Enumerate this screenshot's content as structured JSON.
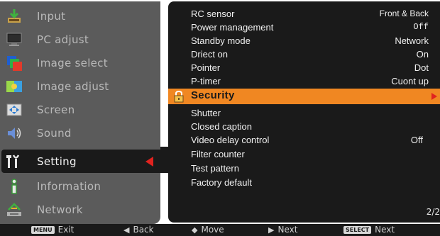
{
  "sidebar": {
    "items": [
      {
        "label": "Input",
        "icon": "input-icon"
      },
      {
        "label": "PC adjust",
        "icon": "pc-adjust-icon"
      },
      {
        "label": "Image select",
        "icon": "image-select-icon"
      },
      {
        "label": "Image adjust",
        "icon": "image-adjust-icon"
      },
      {
        "label": "Screen",
        "icon": "screen-icon"
      },
      {
        "label": "Sound",
        "icon": "sound-icon"
      },
      {
        "label": "Setting",
        "icon": "setting-icon",
        "selected": true
      },
      {
        "label": "Information",
        "icon": "information-icon"
      },
      {
        "label": "Network",
        "icon": "network-icon"
      }
    ]
  },
  "panel": {
    "rows": [
      {
        "label": "RC sensor",
        "value": "Front & Back"
      },
      {
        "label": "Power management",
        "value": "Off"
      },
      {
        "label": "Standby mode",
        "value": "Network"
      },
      {
        "label": "Driect on",
        "value": "On"
      },
      {
        "label": "Pointer",
        "value": "Dot"
      },
      {
        "label": "P-timer",
        "value": "Cuont up"
      },
      {
        "label": "Security",
        "value": "",
        "highlighted": true
      },
      {
        "label": "Shutter",
        "value": ""
      },
      {
        "label": "Closed caption",
        "value": ""
      },
      {
        "label": "Video delay control",
        "value": "Off"
      },
      {
        "label": "Filter counter",
        "value": ""
      },
      {
        "label": "Test pattern",
        "value": ""
      },
      {
        "label": "Factory default",
        "value": ""
      }
    ],
    "page": "2/2"
  },
  "footer": {
    "exit": {
      "badge": "MENU",
      "label": "Exit"
    },
    "back": {
      "glyph": "◀",
      "label": "Back"
    },
    "move": {
      "glyph": "◆",
      "label": "Move"
    },
    "next": {
      "glyph": "▶",
      "label": "Next"
    },
    "select": {
      "badge": "SELECT",
      "label": "Next"
    }
  },
  "colors": {
    "sidebar_bg": "#5b5b5b",
    "panel_bg": "#1a1a1a",
    "highlight": "#f08722",
    "accent_red": "#e0231f"
  }
}
